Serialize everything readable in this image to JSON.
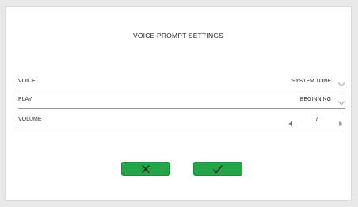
{
  "dialog": {
    "title": "VOICE PROMPT SETTINGS"
  },
  "settings": [
    {
      "label": "VOICE",
      "value": "SYSTEM TONE",
      "control": "chevron-down-icon"
    },
    {
      "label": "PLAY",
      "value": "BEGINNING",
      "control": "chevron-down-icon"
    },
    {
      "label": "VOLUME",
      "value": "7",
      "control": "stepper"
    }
  ],
  "buttons": {
    "cancel_icon": "close-icon",
    "confirm_icon": "checkmark-icon",
    "color": "#22a447"
  },
  "colors": {
    "text": "#2b2b2b",
    "divider": "#9a9a9a",
    "background": "#ffffff"
  }
}
